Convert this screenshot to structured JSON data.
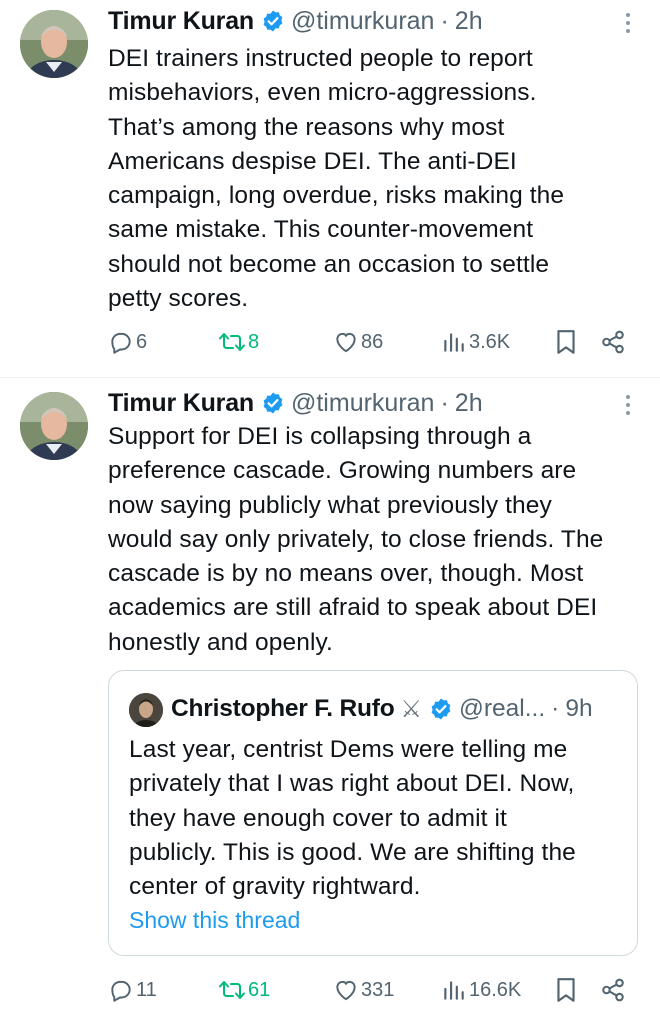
{
  "tweets": [
    {
      "author_name": "Timur Kuran",
      "handle": "@timurkuran",
      "separator": "·",
      "time": "2h",
      "text_lines": [
        "DEI trainers instructed people to report",
        "misbehaviors, even micro-aggressions.",
        "That’s among the reasons why most",
        "Americans despise DEI. The anti-DEI",
        "campaign, long overdue, risks making the",
        "same mistake. This counter-movement",
        "should not become an occasion to settle",
        "petty scores."
      ],
      "replies": "6",
      "reposts": "8",
      "likes": "86",
      "views": "3.6K"
    },
    {
      "author_name": "Timur Kuran",
      "handle": "@timurkuran",
      "separator": "·",
      "time": "2h",
      "text_lines": [
        "Support for DEI is collapsing through a",
        "preference cascade. Growing numbers are",
        "now saying publicly what previously they",
        "would say only privately, to close friends. The",
        "cascade is by no means over, though. Most",
        "academics are still afraid to speak about DEI",
        "honestly and openly."
      ],
      "quote": {
        "author_name": "Christopher F. Rufo",
        "badge_emoji": "⚔",
        "handle": "@real...",
        "separator": "·",
        "time": "9h",
        "text_lines": [
          "Last year, centrist Dems were telling me",
          "privately that I was right about DEI. Now,",
          "they have enough cover to admit it",
          "publicly. This is good. We are shifting the",
          "center of gravity rightward."
        ],
        "show_thread": "Show this thread"
      },
      "replies": "11",
      "reposts": "61",
      "likes": "331",
      "views": "16.6K"
    }
  ],
  "colors": {
    "text": "#0f1419",
    "secondary": "#536471",
    "verified_blue": "#1d9bf0",
    "repost_green": "#00ba7c",
    "link_blue": "#1d9bf0",
    "border": "#cfd9de"
  },
  "icons": [
    "verified-badge-icon",
    "more-icon",
    "reply-icon",
    "repost-icon",
    "like-icon",
    "views-icon",
    "bookmark-icon",
    "share-icon"
  ]
}
